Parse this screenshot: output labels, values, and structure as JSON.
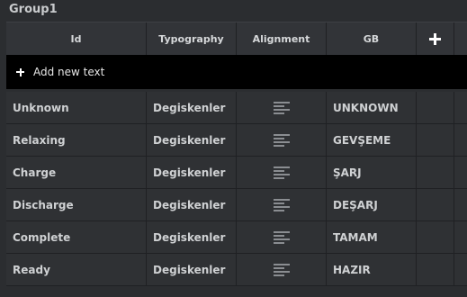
{
  "group": {
    "title": "Group1"
  },
  "header": {
    "id": "Id",
    "typography": "Typography",
    "alignment": "Alignment",
    "gb": "GB"
  },
  "add_row": {
    "label": "Add new text"
  },
  "rows": [
    {
      "id": "Unknown",
      "typography": "Degiskenler",
      "gb": "UNKNOWN"
    },
    {
      "id": "Relaxing",
      "typography": "Degiskenler",
      "gb": "GEVŞEME"
    },
    {
      "id": "Charge",
      "typography": "Degiskenler",
      "gb": "ŞARJ"
    },
    {
      "id": "Discharge",
      "typography": "Degiskenler",
      "gb": "DEŞARJ"
    },
    {
      "id": "Complete",
      "typography": "Degiskenler",
      "gb": "TAMAM"
    },
    {
      "id": "Ready",
      "typography": "Degiskenler",
      "gb": "HAZIR"
    }
  ],
  "icons": {
    "add_column": "plus-icon",
    "add_row": "plus-icon",
    "alignment": "align-left-icon"
  }
}
